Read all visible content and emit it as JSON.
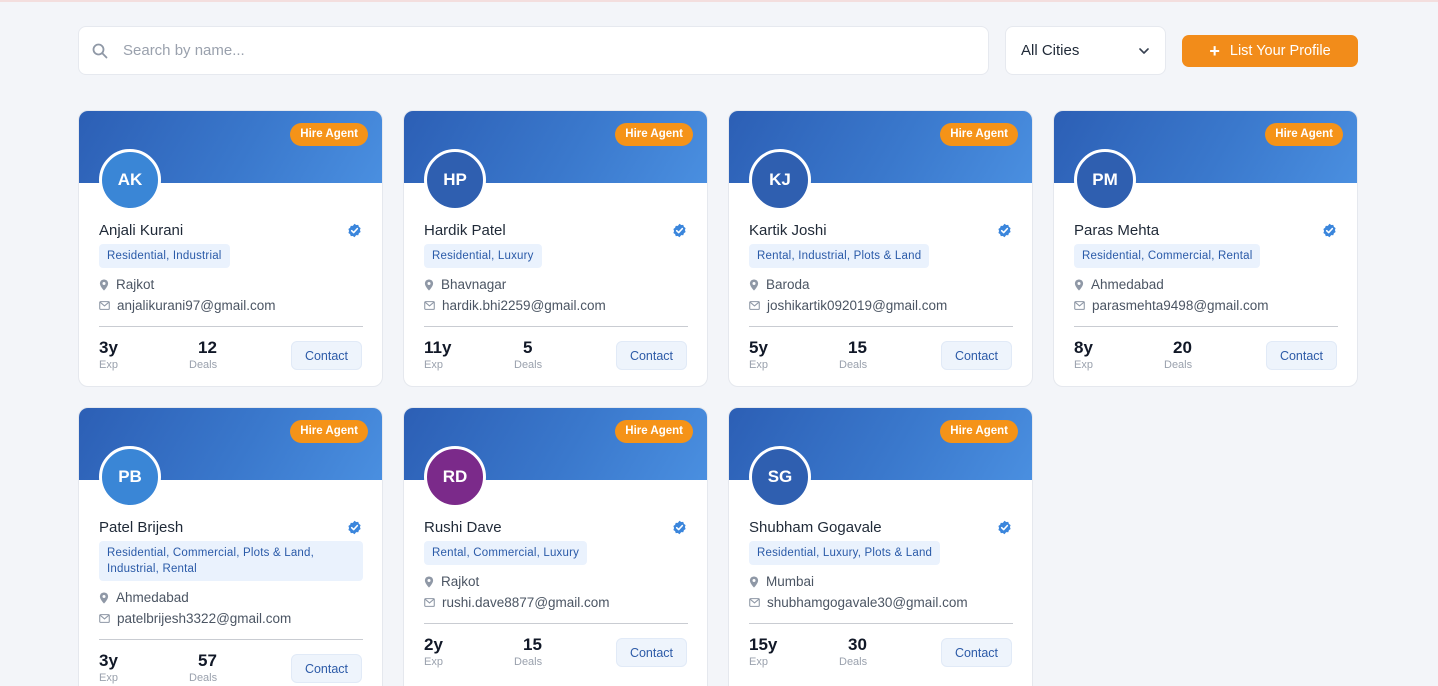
{
  "search": {
    "placeholder": "Search by name...",
    "icon": "search-icon"
  },
  "city_filter": {
    "selected": "All Cities",
    "icon": "chevron-down-icon"
  },
  "list_profile_button": {
    "label": "List Your Profile",
    "icon": "plus-icon"
  },
  "colors": {
    "accent": "#f28c1a",
    "brand_blue": "#2c5fb5",
    "tag_bg": "#eaf2fd",
    "verified": "#3b82f6"
  },
  "agents": [
    {
      "initials": "AK",
      "name": "Anjali Kurani",
      "tags": "Residential, Industrial",
      "city": "Rajkot",
      "email": "anjalikurani97@gmail.com",
      "exp": "3y",
      "exp_label": "Exp",
      "deals": "12",
      "deals_label": "Deals",
      "hire_label": "Hire Agent",
      "contact_label": "Contact",
      "avatar_color": "#3a86d6"
    },
    {
      "initials": "HP",
      "name": "Hardik Patel",
      "tags": "Residential, Luxury",
      "city": "Bhavnagar",
      "email": "hardik.bhi2259@gmail.com",
      "exp": "11y",
      "exp_label": "Exp",
      "deals": "5",
      "deals_label": "Deals",
      "hire_label": "Hire Agent",
      "contact_label": "Contact",
      "avatar_color": "#2f5fb0"
    },
    {
      "initials": "KJ",
      "name": "Kartik Joshi",
      "tags": "Rental, Industrial, Plots & Land",
      "city": "Baroda",
      "email": "joshikartik092019@gmail.com",
      "exp": "5y",
      "exp_label": "Exp",
      "deals": "15",
      "deals_label": "Deals",
      "hire_label": "Hire Agent",
      "contact_label": "Contact",
      "avatar_color": "#2f5fb0"
    },
    {
      "initials": "PM",
      "name": "Paras Mehta",
      "tags": "Residential, Commercial, Rental",
      "city": "Ahmedabad",
      "email": "parasmehta9498@gmail.com",
      "exp": "8y",
      "exp_label": "Exp",
      "deals": "20",
      "deals_label": "Deals",
      "hire_label": "Hire Agent",
      "contact_label": "Contact",
      "avatar_color": "#2f5fb0"
    },
    {
      "initials": "PB",
      "name": "Patel Brijesh",
      "tags": "Residential, Commercial, Plots & Land, Industrial, Rental",
      "city": "Ahmedabad",
      "email": "patelbrijesh3322@gmail.com",
      "exp": "3y",
      "exp_label": "Exp",
      "deals": "57",
      "deals_label": "Deals",
      "hire_label": "Hire Agent",
      "contact_label": "Contact",
      "avatar_color": "#3a86d6"
    },
    {
      "initials": "RD",
      "name": "Rushi Dave",
      "tags": "Rental, Commercial, Luxury",
      "city": "Rajkot",
      "email": "rushi.dave8877@gmail.com",
      "exp": "2y",
      "exp_label": "Exp",
      "deals": "15",
      "deals_label": "Deals",
      "hire_label": "Hire Agent",
      "contact_label": "Contact",
      "avatar_color": "#7b2a8a"
    },
    {
      "initials": "SG",
      "name": "Shubham Gogavale",
      "tags": "Residential, Luxury, Plots & Land",
      "city": "Mumbai",
      "email": "shubhamgogavale30@gmail.com",
      "exp": "15y",
      "exp_label": "Exp",
      "deals": "30",
      "deals_label": "Deals",
      "hire_label": "Hire Agent",
      "contact_label": "Contact",
      "avatar_color": "#2f5fb0"
    }
  ]
}
